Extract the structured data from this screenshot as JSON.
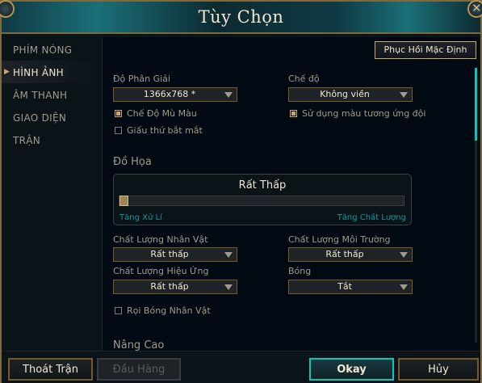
{
  "window": {
    "title": "Tùy Chọn"
  },
  "sidebar": {
    "items": [
      {
        "label": "PHÍM NÓNG",
        "active": false
      },
      {
        "label": "HÌNH ẢNH",
        "active": true
      },
      {
        "label": "ÂM THANH",
        "active": false
      },
      {
        "label": "GIAO DIỆN",
        "active": false
      },
      {
        "label": "TRẬN",
        "active": false
      }
    ]
  },
  "main": {
    "reset_button": "Phục Hồi Mặc Định",
    "resolution": {
      "label": "Độ Phân Giải",
      "value": "1366x768 *"
    },
    "mode": {
      "label": "Chế độ",
      "value": "Không viền"
    },
    "checkboxes": {
      "colorblind": {
        "label": "Chế Độ Mù Màu",
        "checked": true
      },
      "relative_colors": {
        "label": "Sử dụng màu tương ứng đội",
        "checked": true
      },
      "hide_eye_candy": {
        "label": "Giấu thứ bắt mắt",
        "checked": false
      },
      "character_shadows": {
        "label": "Rọi Bóng Nhân Vật",
        "checked": false
      }
    },
    "graphics": {
      "section_title": "Đồ Họa",
      "level_label": "Rất Thấp",
      "slider_value": 0,
      "min_label": "Tăng Xử Lí",
      "max_label": "Tăng Chất Lượng"
    },
    "quality": {
      "character": {
        "label": "Chất Lượng Nhân Vật",
        "value": "Rất thấp"
      },
      "environment": {
        "label": "Chất Lượng Môi Trường",
        "value": "Rất thấp"
      },
      "effects": {
        "label": "Chất Lượng Hiệu Ứng",
        "value": "Rất thấp"
      },
      "shadows": {
        "label": "Bóng",
        "value": "Tắt"
      }
    },
    "advanced_title": "Nâng Cao"
  },
  "footer": {
    "exit_game": "Thoát Trận",
    "surrender": "Đầu Hàng",
    "okay": "Okay",
    "cancel": "Hủy"
  },
  "colors": {
    "gold": "#c8aa6e",
    "teal": "#0ac8b9",
    "text_primary": "#f0e6d2",
    "text_muted": "#a09b8c"
  }
}
